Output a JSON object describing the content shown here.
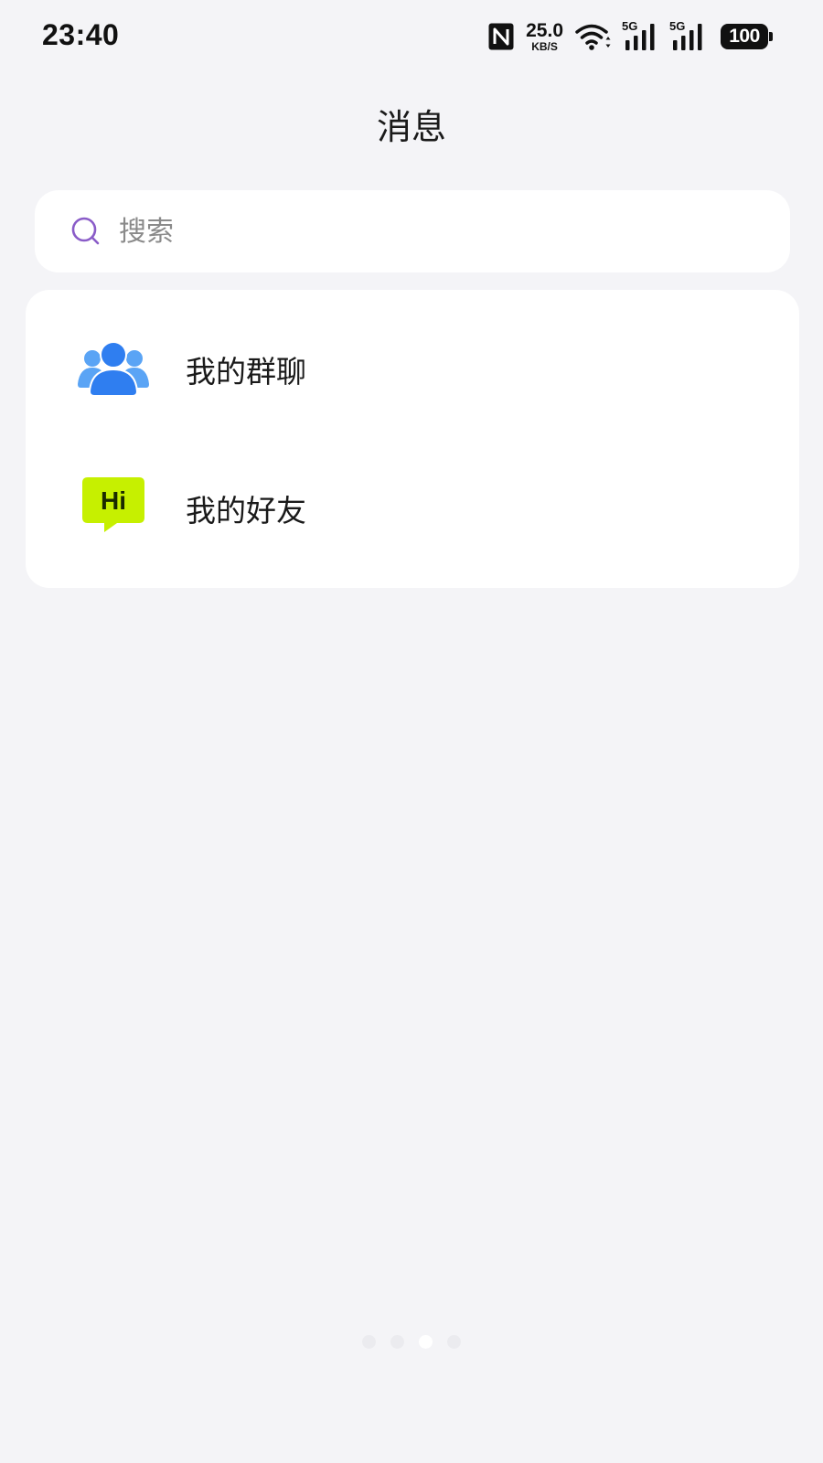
{
  "status_bar": {
    "time": "23:40",
    "net_speed_value": "25.0",
    "net_speed_unit": "KB/S",
    "signal_1_label": "5G",
    "signal_2_label": "5G",
    "battery_level": "100",
    "icons": [
      "nfc-icon",
      "net-speed",
      "wifi-icon",
      "signal-5g-icon",
      "signal-5g-icon",
      "battery-icon"
    ]
  },
  "header": {
    "title": "消息"
  },
  "search": {
    "placeholder": "搜索",
    "value": "",
    "icon": "search-icon",
    "icon_color": "#8a5cc8"
  },
  "list": {
    "items": [
      {
        "label": "我的群聊",
        "icon": "group-chat-icon",
        "icon_color": "#2f7ef0"
      },
      {
        "label": "我的好友",
        "icon": "friends-hi-icon",
        "icon_text": "Hi",
        "icon_color": "#c6f000"
      }
    ]
  },
  "page_indicator": {
    "count": 4,
    "active_index": 2
  },
  "colors": {
    "background": "#f4f4f7",
    "card": "#ffffff",
    "text": "#1a1a1a",
    "placeholder": "#8a8a8a"
  }
}
